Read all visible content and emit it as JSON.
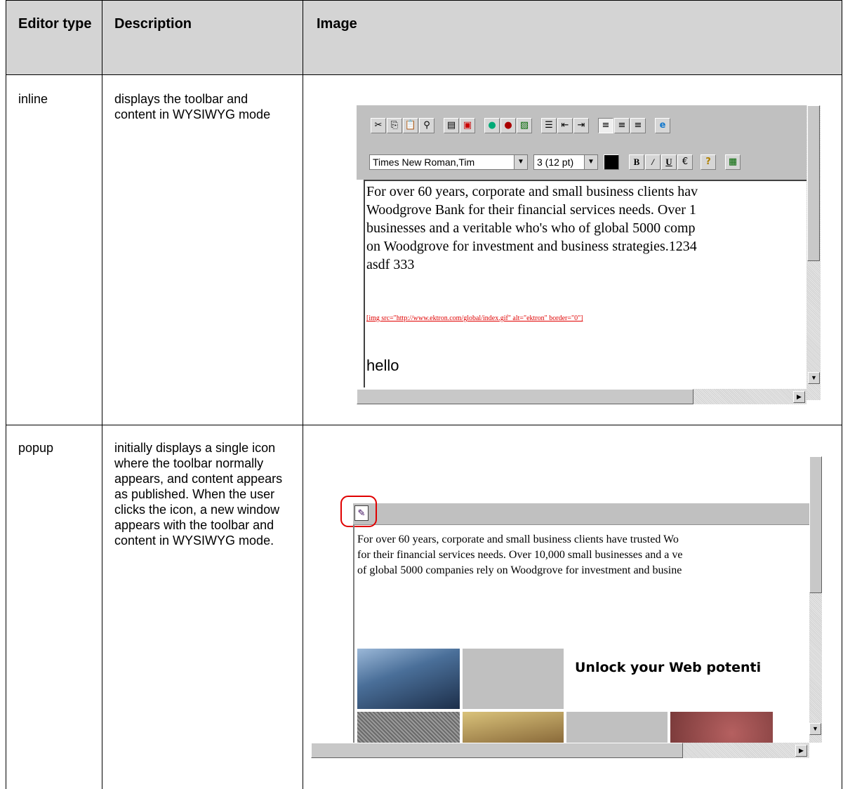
{
  "table": {
    "headers": {
      "editor_type": "Editor type",
      "description": "Description",
      "image": "Image"
    },
    "rows": [
      {
        "type": "inline",
        "description": "displays the toolbar and content in WYSIWYG mode"
      },
      {
        "type": "popup",
        "description": "initially displays a single icon where the toolbar normally appears, and content appears as published. When the user clicks the icon, a new window appears with the toolbar and content in WYSIWYG mode."
      }
    ]
  },
  "inline_editor": {
    "font_select": "Times New Roman,Tim",
    "size_select": "3 (12 pt)",
    "toolbar_icons": [
      "cut-icon",
      "copy-icon",
      "paste-icon",
      "find-icon",
      "document-icon",
      "pdf-icon",
      "link-icon",
      "unlink-icon",
      "image-icon",
      "bullet-list-icon",
      "outdent-icon",
      "indent-icon",
      "align-left-icon",
      "align-center-icon",
      "align-right-icon",
      "web-icon"
    ],
    "content_lines": [
      "For over 60 years, corporate and small business clients hav",
      "Woodgrove Bank for their financial services needs. Over 1",
      "businesses and a veritable who's who of global 5000 comp",
      "on Woodgrove for investment and business strategies.1234",
      "asdf 333"
    ],
    "img_tag": "[img src=\"http://www.ektron.com/global/index.gif\" alt=\"ektron\" border=\"0\"]",
    "hello": "hello"
  },
  "popup_editor": {
    "content_lines": [
      "For over 60 years, corporate and small business clients have trusted Wo",
      "for their financial services needs. Over 10,000 small businesses and a ve",
      "of global 5000 companies rely on Woodgrove for investment and busine"
    ],
    "banner_text": "Unlock your Web potenti",
    "highlight_color": "#e00000"
  }
}
